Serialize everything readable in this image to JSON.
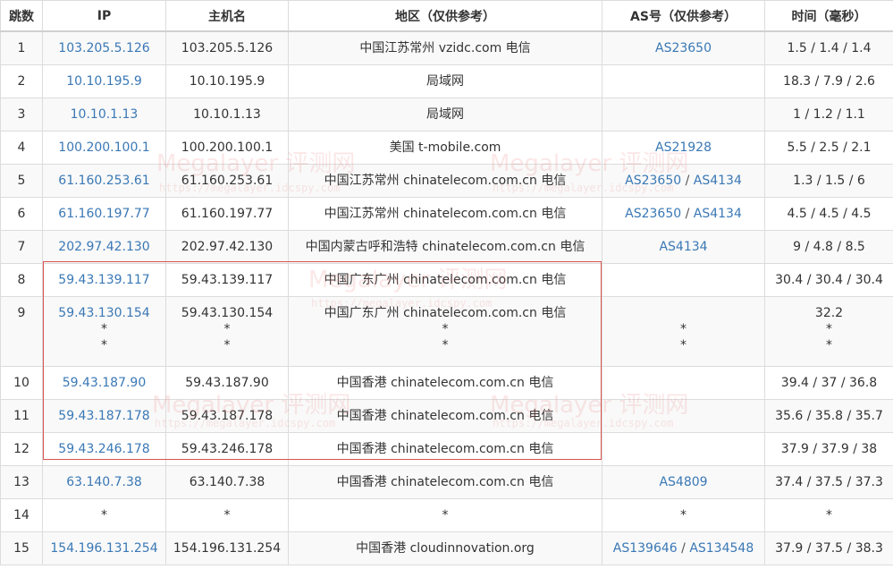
{
  "headers": {
    "hop": "跳数",
    "ip": "IP",
    "host": "主机名",
    "region": "地区（仅供参考）",
    "as": "AS号（仅供参考）",
    "time": "时间（毫秒）"
  },
  "rows": [
    {
      "hop": "1",
      "ips": [
        "103.205.5.126"
      ],
      "hosts": [
        "103.205.5.126"
      ],
      "regions": [
        "中国江苏常州 vzidc.com 电信"
      ],
      "as": [
        "AS23650"
      ],
      "as_extra": "",
      "times": [
        "1.5 / 1.4 / 1.4"
      ]
    },
    {
      "hop": "2",
      "ips": [
        "10.10.195.9"
      ],
      "hosts": [
        "10.10.195.9"
      ],
      "regions": [
        "局域网"
      ],
      "as": [],
      "as_extra": "",
      "times": [
        "18.3 / 7.9 / 2.6"
      ]
    },
    {
      "hop": "3",
      "ips": [
        "10.10.1.13"
      ],
      "hosts": [
        "10.10.1.13"
      ],
      "regions": [
        "局域网"
      ],
      "as": [],
      "as_extra": "",
      "times": [
        "1 / 1.2 / 1.1"
      ]
    },
    {
      "hop": "4",
      "ips": [
        "100.200.100.1"
      ],
      "hosts": [
        "100.200.100.1"
      ],
      "regions": [
        "美国 t-mobile.com"
      ],
      "as": [
        "AS21928"
      ],
      "as_extra": "",
      "times": [
        "5.5 / 2.5 / 2.1"
      ]
    },
    {
      "hop": "5",
      "ips": [
        "61.160.253.61"
      ],
      "hosts": [
        "61.160.253.61"
      ],
      "regions": [
        "中国江苏常州 chinatelecom.com.cn 电信"
      ],
      "as": [
        "AS23650",
        "AS4134"
      ],
      "as_extra": "",
      "times": [
        "1.3 / 1.5 / 6"
      ]
    },
    {
      "hop": "6",
      "ips": [
        "61.160.197.77"
      ],
      "hosts": [
        "61.160.197.77"
      ],
      "regions": [
        "中国江苏常州 chinatelecom.com.cn 电信"
      ],
      "as": [
        "AS23650",
        "AS4134"
      ],
      "as_extra": "",
      "times": [
        "4.5 / 4.5 / 4.5"
      ]
    },
    {
      "hop": "7",
      "ips": [
        "202.97.42.130"
      ],
      "hosts": [
        "202.97.42.130"
      ],
      "regions": [
        "中国内蒙古呼和浩特 chinatelecom.com.cn 电信"
      ],
      "as": [
        "AS4134"
      ],
      "as_extra": "",
      "times": [
        "9 / 4.8 / 8.5"
      ]
    },
    {
      "hop": "8",
      "ips": [
        "59.43.139.117"
      ],
      "hosts": [
        "59.43.139.117"
      ],
      "regions": [
        "中国广东广州 chinatelecom.com.cn 电信"
      ],
      "as": [],
      "as_extra": "",
      "times": [
        "30.4 / 30.4 / 30.4"
      ]
    },
    {
      "hop": "9",
      "ips": [
        "59.43.130.154",
        "*",
        "*"
      ],
      "hosts": [
        "59.43.130.154",
        "*",
        "*"
      ],
      "regions": [
        "中国广东广州 chinatelecom.com.cn 电信",
        "*",
        "*"
      ],
      "as": [],
      "as_extra": "*",
      "times": [
        "32.2",
        "*",
        "*"
      ]
    },
    {
      "hop": "10",
      "ips": [
        "59.43.187.90"
      ],
      "hosts": [
        "59.43.187.90"
      ],
      "regions": [
        "中国香港 chinatelecom.com.cn 电信"
      ],
      "as": [],
      "as_extra": "",
      "times": [
        "39.4 / 37 / 36.8"
      ]
    },
    {
      "hop": "11",
      "ips": [
        "59.43.187.178"
      ],
      "hosts": [
        "59.43.187.178"
      ],
      "regions": [
        "中国香港 chinatelecom.com.cn 电信"
      ],
      "as": [],
      "as_extra": "",
      "times": [
        "35.6 / 35.8 / 35.7"
      ]
    },
    {
      "hop": "12",
      "ips": [
        "59.43.246.178"
      ],
      "hosts": [
        "59.43.246.178"
      ],
      "regions": [
        "中国香港 chinatelecom.com.cn 电信"
      ],
      "as": [],
      "as_extra": "",
      "times": [
        "37.9 / 37.9 / 38"
      ]
    },
    {
      "hop": "13",
      "ips": [
        "63.140.7.38"
      ],
      "hosts": [
        "63.140.7.38"
      ],
      "regions": [
        "中国香港 chinatelecom.com.cn 电信"
      ],
      "as": [
        "AS4809"
      ],
      "as_extra": "",
      "times": [
        "37.4 / 37.5 / 37.3"
      ]
    },
    {
      "hop": "14",
      "ips": [
        "*"
      ],
      "hosts": [
        "*"
      ],
      "regions": [
        "*"
      ],
      "as": [],
      "as_extra": "*",
      "times": [
        "*"
      ]
    },
    {
      "hop": "15",
      "ips": [
        "154.196.131.254"
      ],
      "hosts": [
        "154.196.131.254"
      ],
      "regions": [
        "中国香港 cloudinnovation.org"
      ],
      "as": [
        "AS139646",
        "AS134548"
      ],
      "as_extra": "",
      "times": [
        "37.9 / 37.5 / 38.3"
      ]
    }
  ],
  "as_separator": " / ",
  "watermark": {
    "main": "Megalayer 评测网",
    "sub": "https://megalayer.idcspy.com"
  },
  "colors": {
    "link": "#3a78b5",
    "highlight_border": "#d9534f",
    "row_alt": "#f9f9f9"
  }
}
